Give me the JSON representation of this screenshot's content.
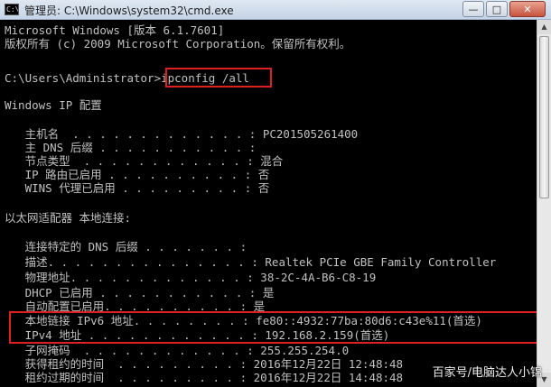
{
  "window": {
    "title": "管理员: C:\\Windows\\system32\\cmd.exe",
    "icon_glyph": "C:\\"
  },
  "console": {
    "lines": [
      "Microsoft Windows [版本 6.1.7601]",
      "版权所有 (c) 2009 Microsoft Corporation。保留所有权利。",
      "",
      "C:\\Users\\Administrator>ipconfig /all",
      "",
      "Windows IP 配置",
      "",
      "   主机名  . . . . . . . . . . . . . : PC201505261400",
      "   主 DNS 后缀 . . . . . . . . . . . :",
      "   节点类型  . . . . . . . . . . . . : 混合",
      "   IP 路由已启用 . . . . . . . . . . : 否",
      "   WINS 代理已启用 . . . . . . . . . : 否",
      "",
      "以太网适配器 本地连接:",
      "",
      "   连接特定的 DNS 后缀 . . . . . . . :",
      "   描述. . . . . . . . . . . . . . . : Realtek PCIe GBE Family Controller",
      "   物理地址. . . . . . . . . . . . . : 38-2C-4A-B6-C8-19",
      "   DHCP 已启用 . . . . . . . . . . . : 是",
      "   自动配置已启用. . . . . . . . . . : 是",
      "   本地链接 IPv6 地址. . . . . . . . : fe80::4932:77ba:80d6:c43e%11(首选)",
      "   IPv4 地址 . . . . . . . . . . . . : 192.168.2.159(首选)",
      "   子网掩码  . . . . . . . . . . . . : 255.255.254.0",
      "   获得租约的时间  . . . . . . . . . : 2016年12月22日 12:48:48",
      "   租约过期的时间  . . . . . . . . . : 2016年12月22日 14:48:48"
    ]
  },
  "controls": {
    "minimize": "—",
    "maximize": "□",
    "close": "✕"
  },
  "scrollbar": {
    "up": "▲",
    "down": "▼"
  },
  "watermark": "百家号/电脑达人小锦"
}
